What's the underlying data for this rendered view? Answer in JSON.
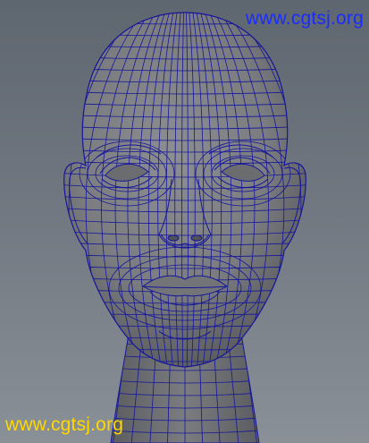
{
  "viewport": {
    "model": "head-mesh",
    "colors": {
      "background_top": "#5e666f",
      "background_bottom": "#8a9097",
      "mesh_fill": "#818386",
      "mesh_shadow": "#55575b",
      "wireframe": "#16169a"
    }
  },
  "watermarks": {
    "top_text": "www.cgtsj.org",
    "bottom_text": "www.cgtsj.org",
    "top_color": "#1a2cff",
    "bottom_color": "#ffd800"
  }
}
